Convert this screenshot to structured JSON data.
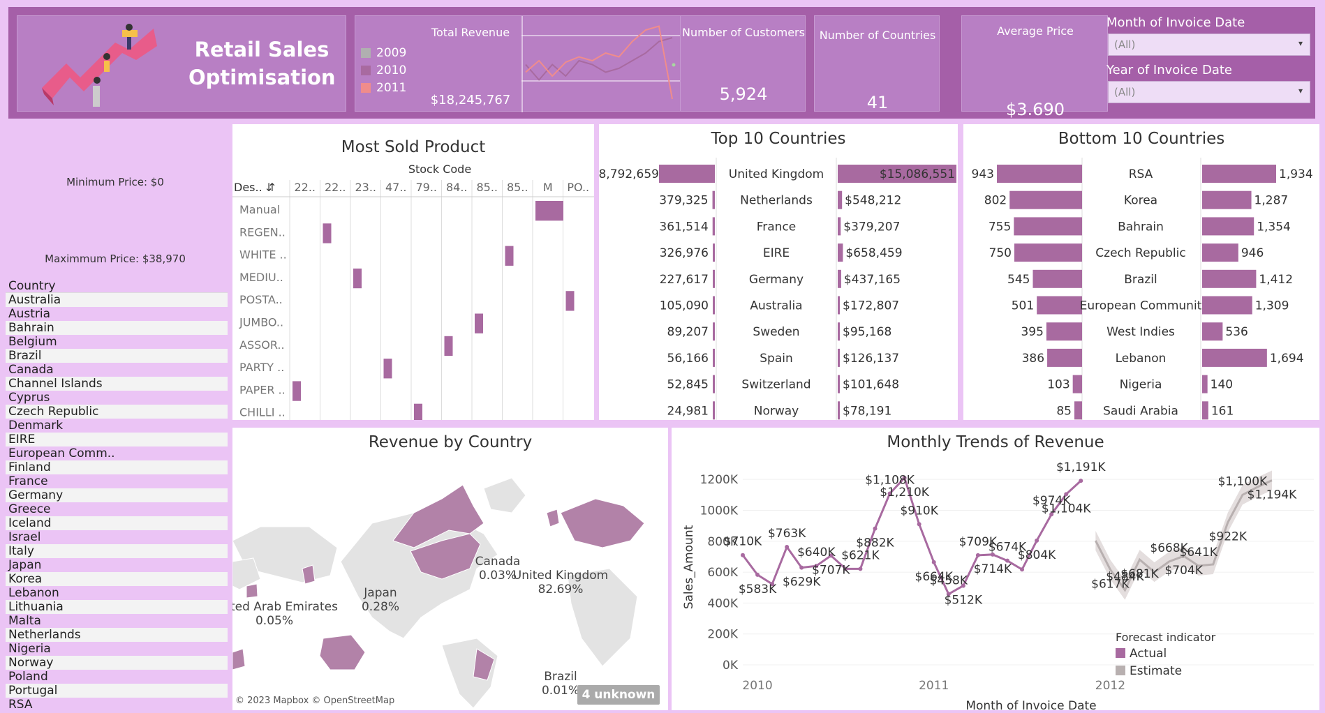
{
  "header": {
    "title_line1": "Retail Sales",
    "title_line2": "Optimisation",
    "total_revenue_label": "Total Revenue",
    "total_revenue_value": "$18,245,767",
    "legend_years": [
      {
        "label": "2009",
        "color": "#b0b0b0"
      },
      {
        "label": "2010",
        "color": "#a86aa0"
      },
      {
        "label": "2011",
        "color": "#f08c8c"
      }
    ],
    "customers_label": "Number of Customers",
    "customers_value": "5,924",
    "countries_label": "Number of Countries",
    "countries_value": "41",
    "avg_price_label": "Average Price",
    "avg_price_value": "$3.690",
    "month_filter_label": "Month of Invoice Date",
    "month_filter_value": "(All)",
    "year_filter_label": "Year of Invoice Date",
    "year_filter_value": "(All)"
  },
  "sidebar": {
    "min_price": "Minimum Price: $0",
    "max_price": "Maximmum Price: $38,970",
    "country_header": "Country",
    "countries": [
      "Australia",
      "Austria",
      "Bahrain",
      "Belgium",
      "Brazil",
      "Canada",
      "Channel Islands",
      "Cyprus",
      "Czech Republic",
      "Denmark",
      "EIRE",
      "European Comm..",
      "Finland",
      "France",
      "Germany",
      "Greece",
      "Iceland",
      "Israel",
      "Italy",
      "Japan",
      "Korea",
      "Lebanon",
      "Lithuania",
      "Malta",
      "Netherlands",
      "Nigeria",
      "Norway",
      "Poland",
      "Portugal",
      "RSA"
    ]
  },
  "most_sold": {
    "title": "Most Sold Product",
    "col_header": "Stock Code",
    "row_header": "Des..",
    "columns": [
      "22..",
      "22..",
      "23..",
      "47..",
      "79..",
      "84..",
      "85..",
      "85..",
      "M",
      "PO.."
    ],
    "rows": [
      "Manual",
      "REGEN..",
      "WHITE ..",
      "MEDIU..",
      "POSTA..",
      "JUMBO..",
      "ASSOR..",
      "PARTY ..",
      "PAPER ..",
      "CHILLI .."
    ],
    "cells": [
      [
        0,
        8
      ],
      [
        1,
        1
      ],
      [
        2,
        7
      ],
      [
        3,
        2
      ],
      [
        4,
        9
      ],
      [
        5,
        6
      ],
      [
        6,
        5
      ],
      [
        7,
        3
      ],
      [
        8,
        0
      ],
      [
        9,
        4
      ]
    ]
  },
  "top10": {
    "title": "Top 10 Countries",
    "rows": [
      {
        "country": "United Kingdom",
        "qty": 8792659,
        "qty_label": "8,792,659",
        "rev": 15086551,
        "rev_label": "$15,086,551"
      },
      {
        "country": "Netherlands",
        "qty": 379325,
        "qty_label": "379,325",
        "rev": 548212,
        "rev_label": "$548,212"
      },
      {
        "country": "France",
        "qty": 361514,
        "qty_label": "361,514",
        "rev": 379207,
        "rev_label": "$379,207"
      },
      {
        "country": "EIRE",
        "qty": 326976,
        "qty_label": "326,976",
        "rev": 658459,
        "rev_label": "$658,459"
      },
      {
        "country": "Germany",
        "qty": 227617,
        "qty_label": "227,617",
        "rev": 437165,
        "rev_label": "$437,165"
      },
      {
        "country": "Australia",
        "qty": 105090,
        "qty_label": "105,090",
        "rev": 172807,
        "rev_label": "$172,807"
      },
      {
        "country": "Sweden",
        "qty": 89207,
        "qty_label": "89,207",
        "rev": 95168,
        "rev_label": "$95,168"
      },
      {
        "country": "Spain",
        "qty": 56166,
        "qty_label": "56,166",
        "rev": 126137,
        "rev_label": "$126,137"
      },
      {
        "country": "Switzerland",
        "qty": 52845,
        "qty_label": "52,845",
        "rev": 101648,
        "rev_label": "$101,648"
      },
      {
        "country": "Norway",
        "qty": 24981,
        "qty_label": "24,981",
        "rev": 78191,
        "rev_label": "$78,191"
      }
    ]
  },
  "bottom10": {
    "title": "Bottom 10 Countries",
    "rows": [
      {
        "country": "RSA",
        "qty": 943,
        "qty_label": "943",
        "rev": 1934,
        "rev_label": "1,934"
      },
      {
        "country": "Korea",
        "qty": 802,
        "qty_label": "802",
        "rev": 1287,
        "rev_label": "1,287"
      },
      {
        "country": "Bahrain",
        "qty": 755,
        "qty_label": "755",
        "rev": 1354,
        "rev_label": "1,354"
      },
      {
        "country": "Czech Republic",
        "qty": 750,
        "qty_label": "750",
        "rev": 946,
        "rev_label": "946"
      },
      {
        "country": "Brazil",
        "qty": 545,
        "qty_label": "545",
        "rev": 1412,
        "rev_label": "1,412"
      },
      {
        "country": "European Communit",
        "qty": 501,
        "qty_label": "501",
        "rev": 1309,
        "rev_label": "1,309"
      },
      {
        "country": "West Indies",
        "qty": 395,
        "qty_label": "395",
        "rev": 536,
        "rev_label": "536"
      },
      {
        "country": "Lebanon",
        "qty": 386,
        "qty_label": "386",
        "rev": 1694,
        "rev_label": "1,694"
      },
      {
        "country": "Nigeria",
        "qty": 103,
        "qty_label": "103",
        "rev": 140,
        "rev_label": "140"
      },
      {
        "country": "Saudi Arabia",
        "qty": 85,
        "qty_label": "85",
        "rev": 161,
        "rev_label": "161"
      }
    ]
  },
  "map": {
    "title": "Revenue by Country",
    "labels": [
      {
        "name": "Canada",
        "value": "0.03%"
      },
      {
        "name": "United Kingdom",
        "value": "82.69%"
      },
      {
        "name": "United Arab Emirates",
        "value": "0.05%"
      },
      {
        "name": "Japan",
        "value": "0.28%"
      },
      {
        "name": "Brazil",
        "value": "0.01%"
      }
    ],
    "attribution": "© 2023 Mapbox © OpenStreetMap",
    "unknown_badge": "4 unknown"
  },
  "chart_data": [
    {
      "type": "line",
      "title": "Monthly Trends of Revenue",
      "xlabel": "Month of Invoice Date",
      "ylabel": "Sales_Amount",
      "x_ticks": [
        "2010",
        "2011",
        "2012"
      ],
      "y_ticks": [
        "0K",
        "200K",
        "400K",
        "600K",
        "800K",
        "1000K",
        "1200K"
      ],
      "ylim": [
        0,
        1300
      ],
      "legend_title": "Forecast indicator",
      "legend": [
        {
          "name": "Actual",
          "color": "#a86aa0"
        },
        {
          "name": "Estimate",
          "color": "#b8b0b0"
        }
      ],
      "series": [
        {
          "name": "Actual",
          "x": [
            "2009-12",
            "2010-01",
            "2010-02",
            "2010-03",
            "2010-04",
            "2010-05",
            "2010-06",
            "2010-07",
            "2010-08",
            "2010-09",
            "2010-10",
            "2010-11",
            "2010-12",
            "2011-01",
            "2011-02",
            "2011-03",
            "2011-04",
            "2011-05",
            "2011-06",
            "2011-07",
            "2011-08",
            "2011-09",
            "2011-10",
            "2011-11",
            "2011-12"
          ],
          "values": [
            710,
            583,
            523,
            763,
            629,
            640,
            707,
            621,
            621,
            882,
            1108,
            1210,
            910,
            664,
            458,
            512,
            709,
            714,
            674,
            617,
            804,
            974,
            1104,
            1191,
            1191
          ]
        },
        {
          "name": "Estimate",
          "x": [
            "2011-12",
            "2012-01",
            "2012-02",
            "2012-03",
            "2012-04",
            "2012-05",
            "2012-06",
            "2012-07",
            "2012-08",
            "2012-09",
            "2012-10",
            "2012-11",
            "2012-12"
          ],
          "values": [
            804,
            617,
            484,
            681,
            600,
            668,
            704,
            641,
            650,
            922,
            1100,
            1150,
            1194
          ]
        }
      ],
      "point_labels": [
        {
          "text": "$710K",
          "i": 0
        },
        {
          "text": "$583K",
          "i": 1
        },
        {
          "text": "$763K",
          "i": 3
        },
        {
          "text": "$629K",
          "i": 4
        },
        {
          "text": "$640K",
          "i": 5
        },
        {
          "text": "$707K",
          "i": 6
        },
        {
          "text": "$621K",
          "i": 8
        },
        {
          "text": "$882K",
          "i": 9
        },
        {
          "text": "$1,108K",
          "i": 10
        },
        {
          "text": "$1,210K",
          "i": 11
        },
        {
          "text": "$910K",
          "i": 12
        },
        {
          "text": "$664K",
          "i": 13
        },
        {
          "text": "$458K",
          "i": 14
        },
        {
          "text": "$512K",
          "i": 15
        },
        {
          "text": "$709K",
          "i": 16
        },
        {
          "text": "$714K",
          "i": 17
        },
        {
          "text": "$674K",
          "i": 18
        },
        {
          "text": "$804K",
          "i": 20
        },
        {
          "text": "$974K",
          "i": 21
        },
        {
          "text": "$1,104K",
          "i": 22
        },
        {
          "text": "$1,191K",
          "i": 23
        }
      ],
      "estimate_labels": [
        {
          "text": "$617K",
          "i": 1
        },
        {
          "text": "$484K",
          "i": 2
        },
        {
          "text": "$681K",
          "i": 3
        },
        {
          "text": "$668K",
          "i": 5
        },
        {
          "text": "$704K",
          "i": 6
        },
        {
          "text": "$641K",
          "i": 7
        },
        {
          "text": "$922K",
          "i": 9
        },
        {
          "text": "$1,100K",
          "i": 10
        },
        {
          "text": "$1,194K",
          "i": 12
        }
      ]
    },
    {
      "type": "line",
      "title": "Total Revenue sparkline",
      "series": [
        {
          "name": "2010",
          "values": [
            55,
            35,
            55,
            40,
            60,
            55,
            45,
            50,
            60,
            70,
            85,
            90
          ]
        },
        {
          "name": "2011",
          "values": [
            45,
            60,
            40,
            58,
            65,
            60,
            70,
            65,
            85,
            100,
            105,
            10
          ]
        }
      ]
    }
  ]
}
